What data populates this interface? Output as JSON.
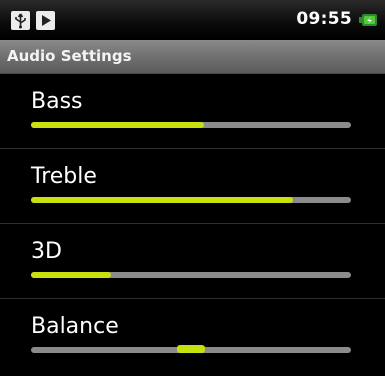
{
  "status_bar": {
    "time": "09:55",
    "icons": [
      "usb-icon",
      "play-icon",
      "battery-charging-icon"
    ]
  },
  "title_bar": {
    "title": "Audio Settings"
  },
  "settings": [
    {
      "label": "Bass",
      "level": 0.54
    },
    {
      "label": "Treble",
      "level": 0.82
    },
    {
      "label": "3D",
      "level": 0.25
    },
    {
      "label": "Balance",
      "level": 0.5,
      "style": "center"
    }
  ],
  "colors": {
    "accent": "#c9e00f",
    "track": "#8b8b8b",
    "background": "#000000",
    "title_bar": "#6e6e6e"
  }
}
